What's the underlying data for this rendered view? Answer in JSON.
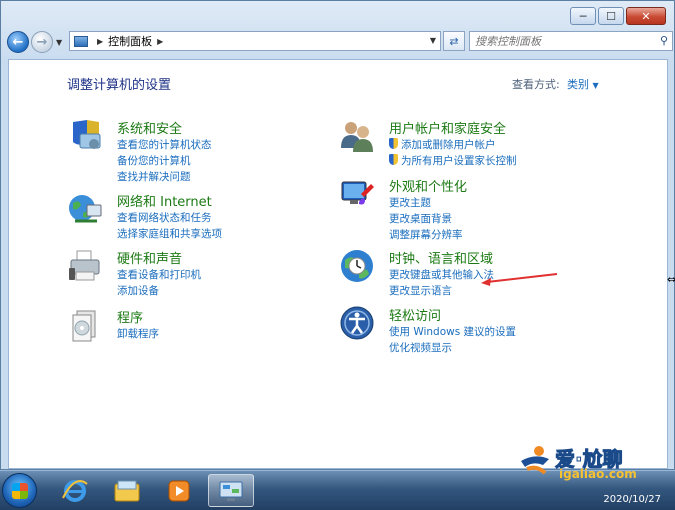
{
  "window": {
    "caption_buttons": [
      "minimize-icon",
      "maximize-icon",
      "close-icon"
    ]
  },
  "navbar": {
    "breadcrumb": [
      "控制面板"
    ],
    "search_placeholder": "搜索控制面板"
  },
  "page": {
    "title": "调整计算机的设置",
    "view_by_label": "查看方式:",
    "view_by_value": "类别"
  },
  "categories": [
    {
      "heading": "系统和安全",
      "icon": "shield-computer-icon",
      "links": [
        "查看您的计算机状态",
        "备份您的计算机",
        "查找并解决问题"
      ]
    },
    {
      "heading": "网络和 Internet",
      "icon": "globe-network-icon",
      "links": [
        "查看网络状态和任务",
        "选择家庭组和共享选项"
      ]
    },
    {
      "heading": "硬件和声音",
      "icon": "printer-icon",
      "links": [
        "查看设备和打印机",
        "添加设备"
      ]
    },
    {
      "heading": "程序",
      "icon": "programs-icon",
      "links": [
        "卸载程序"
      ]
    },
    {
      "heading": "用户帐户和家庭安全",
      "icon": "users-icon",
      "links": [
        "添加或删除用户帐户",
        "为所有用户设置家长控制"
      ]
    },
    {
      "heading": "外观和个性化",
      "icon": "display-icon",
      "links": [
        "更改主题",
        "更改桌面背景",
        "调整屏幕分辨率"
      ]
    },
    {
      "heading": "时钟、语言和区域",
      "icon": "clock-globe-icon",
      "links": [
        "更改键盘或其他输入法",
        "更改显示语言"
      ]
    },
    {
      "heading": "轻松访问",
      "icon": "ease-of-access-icon",
      "links": [
        "使用 Windows 建议的设置",
        "优化视频显示"
      ]
    }
  ],
  "taskbar": {
    "items": [
      "start-button",
      "internet-explorer-icon",
      "file-explorer-icon",
      "media-player-icon",
      "control-panel-icon"
    ],
    "date": "2020/10/27"
  },
  "watermark": {
    "text": "爱·尬聊",
    "url": "igaliao.com"
  },
  "colors": {
    "heading_green": "#1c7a14",
    "link_blue": "#1a6dbd",
    "title_blue": "#1e3287",
    "annotation_red": "#e03030"
  }
}
